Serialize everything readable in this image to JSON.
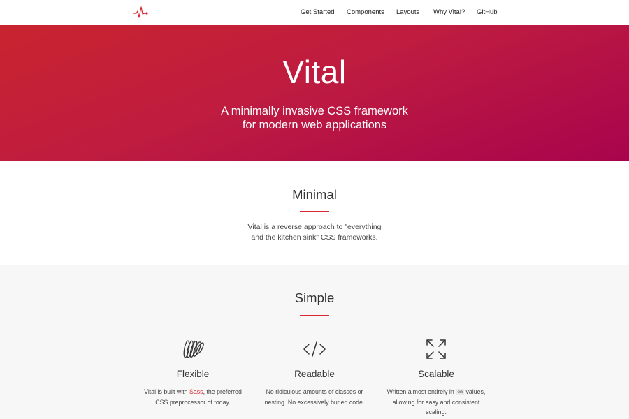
{
  "nav": {
    "items": [
      {
        "label": "Get Started"
      },
      {
        "label": "Components"
      },
      {
        "label": "Layouts"
      },
      {
        "label": "Why Vital?"
      },
      {
        "label": "GitHub"
      }
    ]
  },
  "hero": {
    "title": "Vital",
    "subtitle_line1": "A minimally invasive CSS framework",
    "subtitle_line2": "for modern web applications"
  },
  "minimal": {
    "title": "Minimal",
    "text_line1": "Vital is a reverse approach to \"everything",
    "text_line2": "and the kitchen sink\" CSS frameworks."
  },
  "simple": {
    "title": "Simple",
    "features": [
      {
        "icon": "sass-icon",
        "title": "Flexible",
        "text_before": "Vital is built with ",
        "link": "Sass",
        "text_after": ", the preferred",
        "text_line2": "CSS preprocessor of today."
      },
      {
        "icon": "code-icon",
        "title": "Readable",
        "text_line1": "No ridiculous amounts of classes or",
        "text_line2": "nesting. No excessively buried code."
      },
      {
        "icon": "expand-icon",
        "title": "Scalable",
        "text_before": "Written almost entirely in ",
        "code": "em",
        "text_after": " values,",
        "text_line2": "allowing for easy and consistent",
        "text_line3": "scaling."
      }
    ]
  },
  "colors": {
    "accent": "#d9262f",
    "hero_start": "#c9242f",
    "hero_end": "#a8044d",
    "section_bg": "#f7f7f7"
  }
}
